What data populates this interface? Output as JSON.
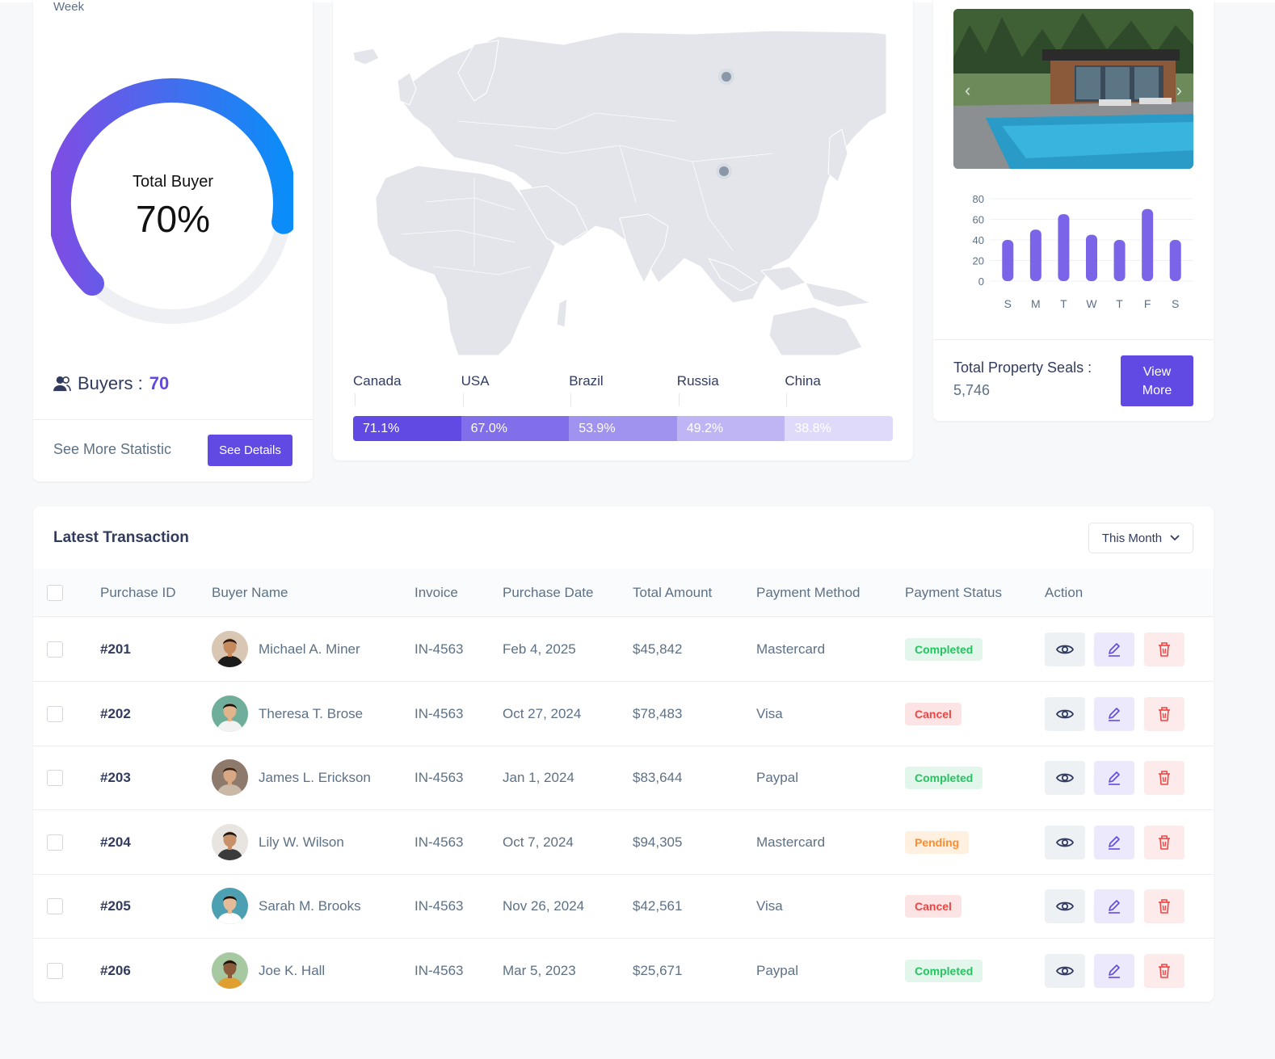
{
  "buyer_card": {
    "period_label": "Week",
    "gauge_title": "Total Buyer",
    "gauge_value": "70%",
    "gauge_percent": 70,
    "buyers_label": "Buyers :",
    "buyers_value": "70",
    "see_more_text": "See More Statistic",
    "details_button": "See Details",
    "gauge_colors": {
      "start": "#7c4ee4",
      "end": "#0a8df8",
      "track": "#eef0f4"
    }
  },
  "map_card": {
    "countries": [
      {
        "name": "Canada",
        "percent_label": "71.1%",
        "color": "#604ae3"
      },
      {
        "name": "USA",
        "percent_label": "67.0%",
        "color": "#806eea"
      },
      {
        "name": "Brazil",
        "percent_label": "53.9%",
        "color": "#a092ef"
      },
      {
        "name": "Russia",
        "percent_label": "49.2%",
        "color": "#bfb5f4"
      },
      {
        "name": "China",
        "percent_label": "38.8%",
        "color": "#dfdaf9"
      }
    ]
  },
  "property_card": {
    "chart_data": {
      "type": "bar",
      "categories": [
        "S",
        "M",
        "T",
        "W",
        "T",
        "F",
        "S"
      ],
      "values": [
        40,
        50,
        65,
        45,
        40,
        70,
        40
      ],
      "ylim": [
        0,
        80
      ],
      "yticks": [
        "80",
        "60",
        "40",
        "20",
        "0"
      ],
      "bar_color": "#7c64e8"
    },
    "seals_label": "Total Property Seals :",
    "seals_value": "5,746",
    "view_more_button": "View More"
  },
  "transactions": {
    "title": "Latest Transaction",
    "filter_value": "This Month",
    "columns": [
      "Purchase ID",
      "Buyer Name",
      "Invoice",
      "Purchase Date",
      "Total Amount",
      "Payment Method",
      "Payment Status",
      "Action"
    ],
    "rows": [
      {
        "id": "#201",
        "buyer": "Michael A. Miner",
        "invoice": "IN-4563",
        "date": "Feb 4, 2025",
        "amount": "$45,842",
        "method": "Mastercard",
        "status": "Completed",
        "status_type": "completed"
      },
      {
        "id": "#202",
        "buyer": "Theresa T. Brose",
        "invoice": "IN-4563",
        "date": "Oct 27, 2024",
        "amount": "$78,483",
        "method": "Visa",
        "status": "Cancel",
        "status_type": "cancel"
      },
      {
        "id": "#203",
        "buyer": "James L. Erickson",
        "invoice": "IN-4563",
        "date": "Jan 1, 2024",
        "amount": "$83,644",
        "method": "Paypal",
        "status": "Completed",
        "status_type": "completed"
      },
      {
        "id": "#204",
        "buyer": "Lily W. Wilson",
        "invoice": "IN-4563",
        "date": "Oct 7, 2024",
        "amount": "$94,305",
        "method": "Mastercard",
        "status": "Pending",
        "status_type": "pending"
      },
      {
        "id": "#205",
        "buyer": "Sarah M. Brooks",
        "invoice": "IN-4563",
        "date": "Nov 26, 2024",
        "amount": "$42,561",
        "method": "Visa",
        "status": "Cancel",
        "status_type": "cancel"
      },
      {
        "id": "#206",
        "buyer": "Joe K. Hall",
        "invoice": "IN-4563",
        "date": "Mar 5, 2023",
        "amount": "$25,671",
        "method": "Paypal",
        "status": "Completed",
        "status_type": "completed"
      }
    ]
  },
  "icons": {
    "buyers": "users-icon",
    "dropdown": "chevron-down-icon",
    "view": "eye-icon",
    "edit": "pencil-icon",
    "delete": "trash-icon"
  },
  "accent_color": "#604ae3"
}
